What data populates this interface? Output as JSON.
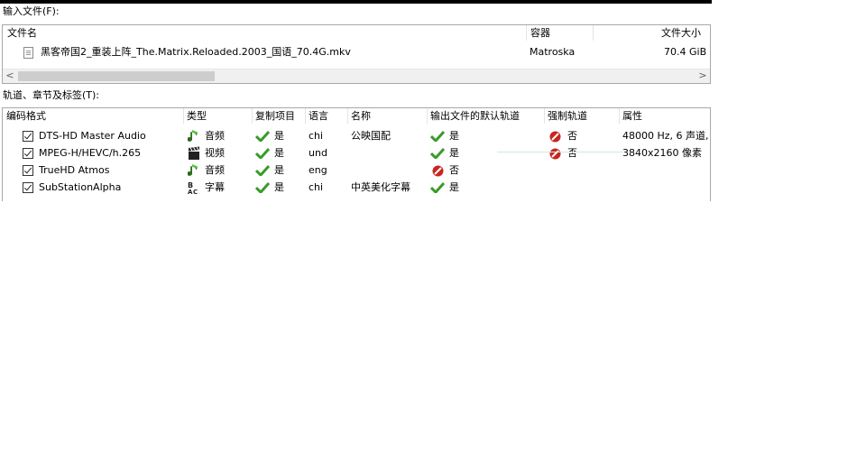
{
  "input_files": {
    "label": "输入文件(F):",
    "columns": [
      "文件名",
      "容器",
      "文件大小"
    ],
    "files": [
      {
        "name": "黑客帝国2_重装上阵_The.Matrix.Reloaded.2003_国语_70.4G.mkv",
        "container": "Matroska",
        "size": "70.4 GiB"
      }
    ],
    "scroll_left_glyph": "<",
    "scroll_right_glyph": ">"
  },
  "tracks": {
    "label": "轨道、章节及标签(T):",
    "columns": [
      "编码格式",
      "类型",
      "复制项目",
      "语言",
      "名称",
      "输出文件的默认轨道",
      "强制轨道",
      "属性"
    ],
    "rows": [
      {
        "checked": true,
        "codec": "DTS-HD Master Audio",
        "type_icon": "music-note-icon",
        "type": "音频",
        "copy": "是",
        "language": "chi",
        "name": "公映国配",
        "default": "是",
        "default_ok": true,
        "forced": "否",
        "forced_ok": false,
        "properties": "48000 Hz, 6 声道,"
      },
      {
        "checked": true,
        "codec": "MPEG-H/HEVC/h.265",
        "type_icon": "film-clapper-icon",
        "type": "视频",
        "copy": "是",
        "language": "und",
        "name": "",
        "default": "是",
        "default_ok": true,
        "forced": "否",
        "forced_ok": false,
        "properties": "3840x2160 像素"
      },
      {
        "checked": true,
        "codec": "TrueHD Atmos",
        "type_icon": "music-note-icon",
        "type": "音频",
        "copy": "是",
        "language": "eng",
        "name": "",
        "default": "否",
        "default_ok": false,
        "forced": "",
        "forced_ok": null,
        "properties": ""
      },
      {
        "checked": true,
        "codec": "SubStationAlpha",
        "type_icon": "subtitle-abc-icon",
        "type": "字幕",
        "copy": "是",
        "language": "chi",
        "name": "中英美化字幕",
        "default": "是",
        "default_ok": true,
        "forced": "",
        "forced_ok": null,
        "properties": ""
      }
    ]
  },
  "colors": {
    "check_green": "#3a9a2a",
    "deny_red": "#c8261e",
    "border": "#a8a8a8"
  }
}
